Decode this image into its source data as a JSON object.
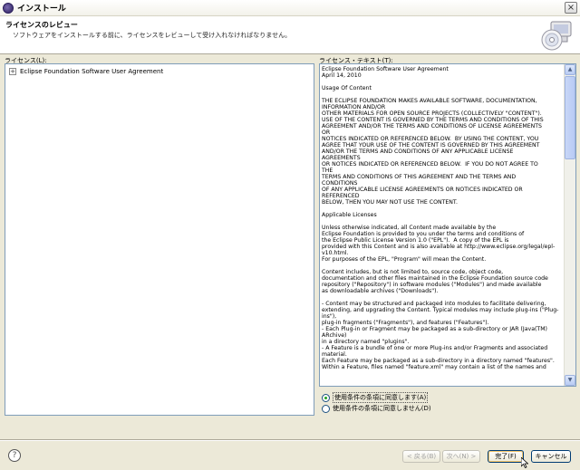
{
  "window": {
    "title": "インストール"
  },
  "banner": {
    "title": "ライセンスのレビュー",
    "description": "ソフトウェアをインストールする前に、ライセンスをレビューして受け入れなければなりません。"
  },
  "licenses_panel": {
    "label": "ライセンス(L):",
    "items": [
      {
        "toggle": "+",
        "label": "Eclipse Foundation Software User Agreement"
      }
    ]
  },
  "license_text": {
    "label": "ライセンス・テキスト(T):",
    "lines": [
      "Eclipse Foundation Software User Agreement",
      "April 14, 2010",
      "",
      "Usage Of Content",
      "",
      "THE ECLIPSE FOUNDATION MAKES AVAILABLE SOFTWARE, DOCUMENTATION,",
      "INFORMATION AND/OR",
      "OTHER MATERIALS FOR OPEN SOURCE PROJECTS (COLLECTIVELY \"CONTENT\").",
      "USE OF THE CONTENT IS GOVERNED BY THE TERMS AND CONDITIONS OF THIS",
      "AGREEMENT AND/OR THE TERMS AND CONDITIONS OF LICENSE AGREEMENTS",
      "OR",
      "NOTICES INDICATED OR REFERENCED BELOW.  BY USING THE CONTENT, YOU",
      "AGREE THAT YOUR USE OF THE CONTENT IS GOVERNED BY THIS AGREEMENT",
      "AND/OR THE TERMS AND CONDITIONS OF ANY APPLICABLE LICENSE",
      "AGREEMENTS",
      "OR NOTICES INDICATED OR REFERENCED BELOW.  IF YOU DO NOT AGREE TO",
      "THE",
      "TERMS AND CONDITIONS OF THIS AGREEMENT AND THE TERMS AND",
      "CONDITIONS",
      "OF ANY APPLICABLE LICENSE AGREEMENTS OR NOTICES INDICATED OR",
      "REFERENCED",
      "BELOW, THEN YOU MAY NOT USE THE CONTENT.",
      "",
      "Applicable Licenses",
      "",
      "Unless otherwise indicated, all Content made available by the",
      "Eclipse Foundation is provided to you under the terms and conditions of",
      "the Eclipse Public License Version 1.0 (\"EPL\").  A copy of the EPL is",
      "provided with this Content and is also available at http://www.eclipse.org/legal/epl-",
      "v10.html.",
      "For purposes of the EPL, \"Program\" will mean the Content.",
      "",
      "Content includes, but is not limited to, source code, object code,",
      "documentation and other files maintained in the Eclipse Foundation source code",
      "repository (\"Repository\") in software modules (\"Modules\") and made available",
      "as downloadable archives (\"Downloads\").",
      "",
      "- Content may be structured and packaged into modules to facilitate delivering,",
      "extending, and upgrading the Content. Typical modules may include plug-ins (\"Plug-",
      "ins\"),",
      "plug-in fragments (\"Fragments\"), and features (\"Features\").",
      "- Each Plug-in or Fragment may be packaged as a sub-directory or JAR (Java(TM)",
      "ARchive)",
      "in a directory named \"plugins\".",
      "- A Feature is a bundle of one or more Plug-ins and/or Fragments and associated",
      "material.",
      "Each Feature may be packaged as a sub-directory in a directory named \"features\".",
      "Within a Feature, files named \"feature.xml\" may contain a list of the names and"
    ]
  },
  "options": {
    "accept": "使用条件の条項に同意します(A)",
    "decline": "使用条件の条項に同意しません(D)",
    "selected": "accept"
  },
  "buttons": {
    "help": "?",
    "back": "< 戻る(B)",
    "next": "次へ(N) >",
    "finish": "完了(F)",
    "cancel": "キャンセル"
  }
}
